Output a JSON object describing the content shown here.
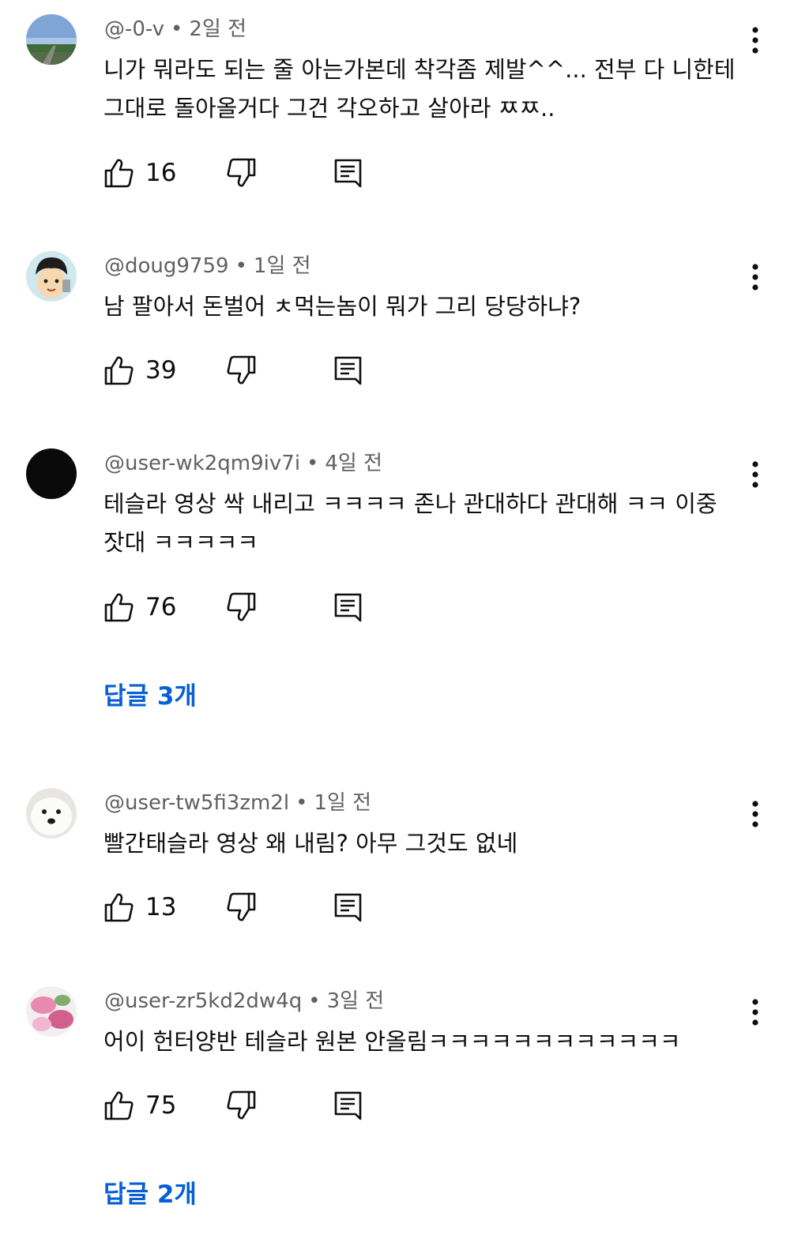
{
  "comments": [
    {
      "author": "@-0-v",
      "time": "2일 전",
      "text": "니가 뭐라도 되는 줄 아는가본데 착각좀 제발^^... 전부 다 니한테 그대로 돌아올거다 그건 각오하고 살아라 ㅉㅉ..",
      "likes": "16",
      "avatar_icon": "landscape-avatar-icon"
    },
    {
      "author": "@doug9759",
      "time": "1일 전",
      "text": "남 팔아서 돈벌어 ㅊ먹는놈이 뭐가 그리 당당하냐?",
      "likes": "39",
      "avatar_icon": "cartoon-face-avatar-icon"
    },
    {
      "author": "@user-wk2qm9iv7i",
      "time": "4일 전",
      "text": "테슬라 영상 싹 내리고 ㅋㅋㅋㅋ 존나 관대하다 관대해 ㅋㅋ 이중잣대 ㅋㅋㅋㅋㅋ",
      "likes": "76",
      "avatar_icon": "black-circle-avatar-icon",
      "replies_label": "답글 3개"
    },
    {
      "author": "@user-tw5fi3zm2l",
      "time": "1일 전",
      "text": "빨간태슬라 영상 왜 내림? 아무 그것도 없네",
      "likes": "13",
      "avatar_icon": "white-dog-avatar-icon"
    },
    {
      "author": "@user-zr5kd2dw4q",
      "time": "3일 전",
      "text": "어이 헌터양반 테슬라 원본 안올림ㅋㅋㅋㅋㅋㅋㅋㅋㅋㅋㅋㅋ",
      "likes": "75",
      "avatar_icon": "pink-flower-avatar-icon",
      "replies_label": "답글 2개"
    }
  ],
  "icons": {
    "like": "thumbs-up-icon",
    "dislike": "thumbs-down-icon",
    "reply": "reply-icon",
    "more": "more-vert-icon"
  },
  "colors": {
    "meta_text": "#606060",
    "body_text": "#0f0f0f",
    "link": "#065fd4"
  }
}
